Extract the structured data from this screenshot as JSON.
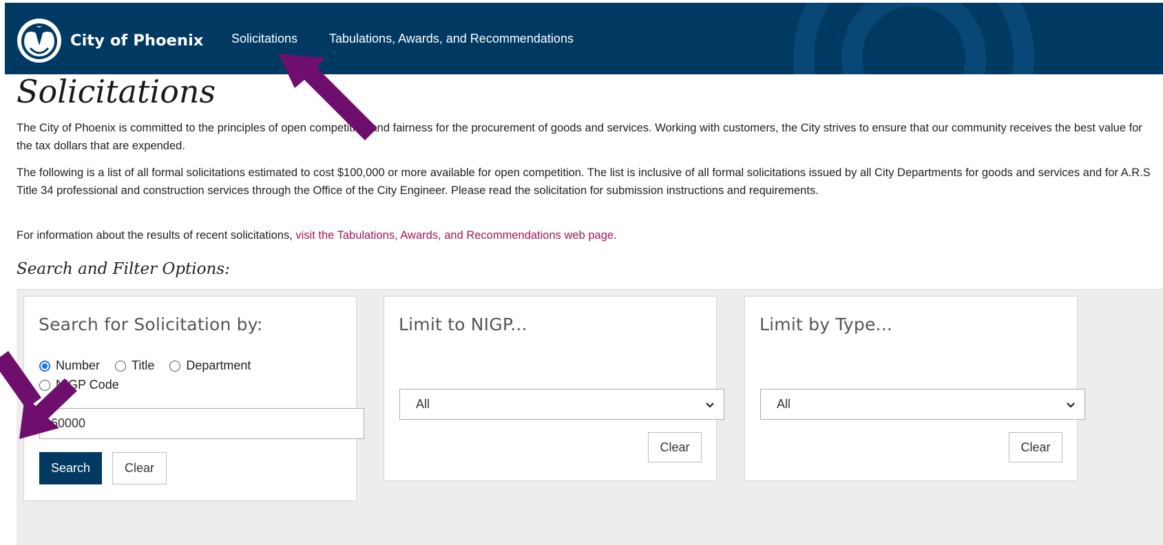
{
  "header": {
    "brand_name": "City of Phoenix",
    "brand_color": "#003a63",
    "nav": [
      {
        "label": "Solicitations"
      },
      {
        "label": "Tabulations, Awards, and Recommendations"
      }
    ]
  },
  "main": {
    "title": "Solicitations",
    "intro": "The City of Phoenix is committed to the principles of open competition and fairness for the procurement of goods and services. Working with customers, the City strives to ensure that our community receives the best value for the tax dollars that are expended.",
    "description": "The following is a list of all formal solicitations estimated to cost $100,000 or more available for open competition. The list is inclusive of all formal solicitations issued by all City Departments for goods and services and for A.R.S Title 34 professional and construction services through the Office of the City Engineer. Please read the solicitation for submission instructions and requirements.",
    "results_prefix": "For information about the results of recent solicitations, ",
    "results_link": "visit the Tabulations, Awards, and Recommendations web page",
    "results_suffix": ".",
    "link_color": "#a0165c"
  },
  "filters": {
    "title": "Search and Filter Options:",
    "search": {
      "title": "Search for Solicitation by:",
      "options": [
        {
          "label": "Number",
          "checked": true
        },
        {
          "label": "Title",
          "checked": false
        },
        {
          "label": "Department",
          "checked": false
        },
        {
          "label": "NIGP Code",
          "checked": false
        }
      ],
      "input_value": "60000",
      "search_label": "Search",
      "clear_label": "Clear"
    },
    "nigp": {
      "title": "Limit to NIGP...",
      "selected": "All",
      "clear_label": "Clear"
    },
    "type": {
      "title": "Limit by Type...",
      "selected": "All",
      "clear_label": "Clear"
    }
  },
  "annotations": {
    "arrow_color": "#6e0f6e",
    "arrow_icon": "annotation-arrow-icon"
  }
}
